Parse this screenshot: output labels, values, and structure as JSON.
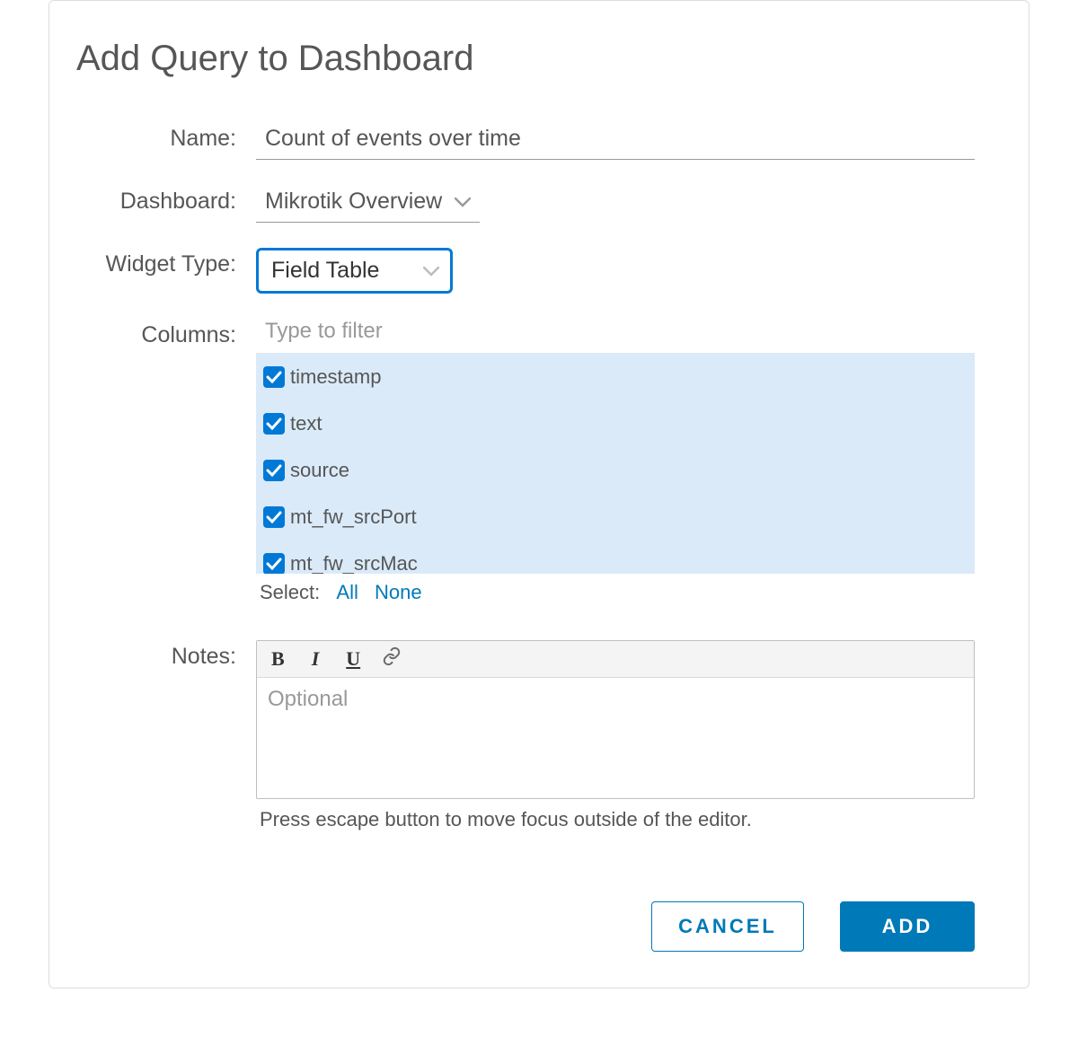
{
  "dialog": {
    "title": "Add Query to Dashboard",
    "labels": {
      "name": "Name:",
      "dashboard": "Dashboard:",
      "widget_type": "Widget Type:",
      "columns": "Columns:",
      "notes": "Notes:"
    },
    "name_value": "Count of events over time",
    "dashboard_value": "Mikrotik Overview",
    "widget_type_value": "Field Table",
    "columns_filter_placeholder": "Type to filter",
    "columns": [
      {
        "label": "timestamp",
        "checked": true
      },
      {
        "label": "text",
        "checked": true
      },
      {
        "label": "source",
        "checked": true
      },
      {
        "label": "mt_fw_srcPort",
        "checked": true
      },
      {
        "label": "mt_fw_srcMac",
        "checked": true
      }
    ],
    "select_label": "Select:",
    "select_all": "All",
    "select_none": "None",
    "notes_placeholder": "Optional",
    "notes_hint": "Press escape button to move focus outside of the editor.",
    "cancel_label": "CANCEL",
    "add_label": "ADD"
  }
}
